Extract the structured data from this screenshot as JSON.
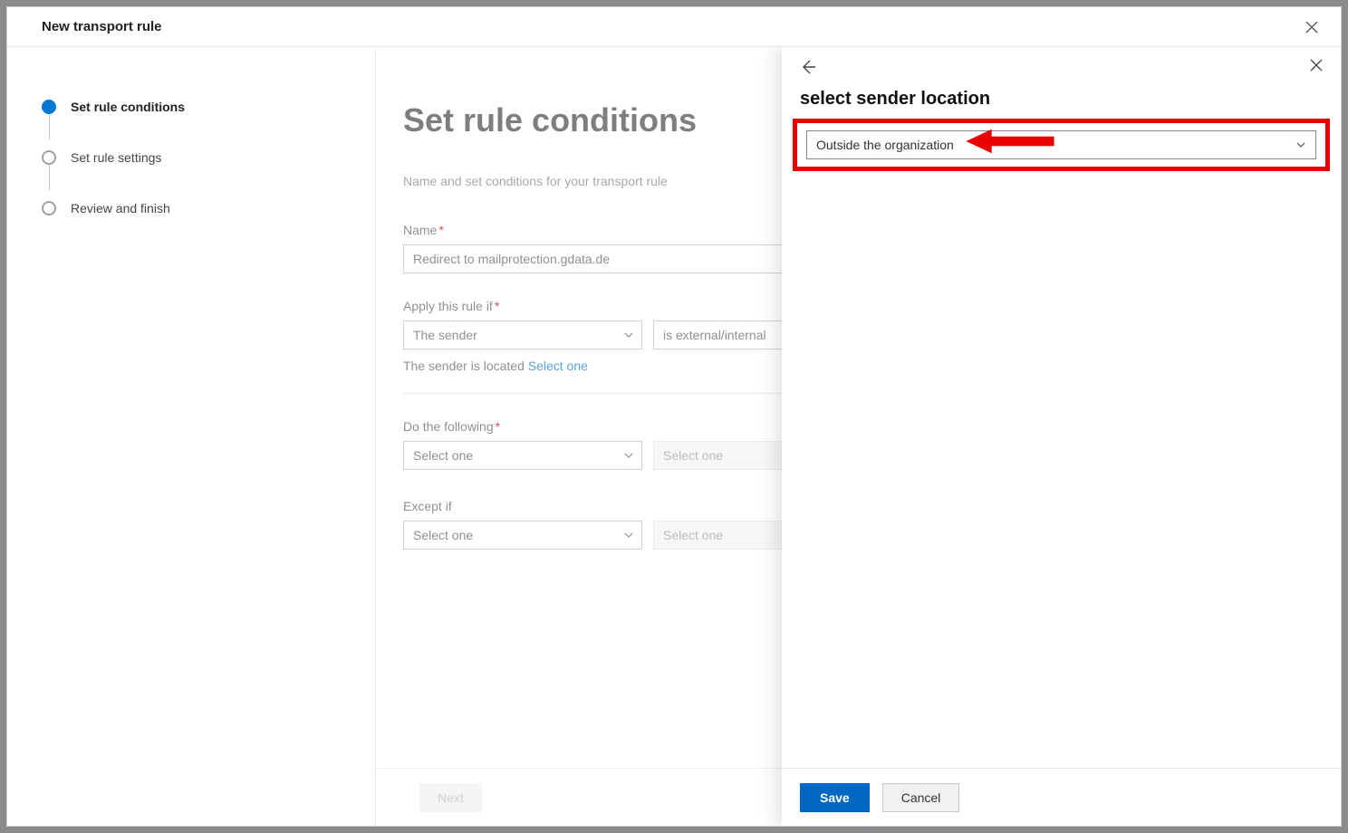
{
  "header": {
    "title": "New transport rule"
  },
  "sidebar": {
    "steps": [
      {
        "label": "Set rule conditions"
      },
      {
        "label": "Set rule settings"
      },
      {
        "label": "Review and finish"
      }
    ]
  },
  "main": {
    "heading": "Set rule conditions",
    "subheading": "Name and set conditions for your transport rule",
    "name_label": "Name",
    "name_value": "Redirect to mailprotection.gdata.de",
    "apply_if_label": "Apply this rule if",
    "apply_if_dd1": "The sender",
    "apply_if_dd2": "is external/internal",
    "sender_located_prefix": "The sender is located ",
    "sender_located_link": "Select one",
    "do_following_label": "Do the following",
    "do_following_dd1": "Select one",
    "do_following_dd2": "Select one",
    "except_if_label": "Except if",
    "except_if_dd1": "Select one",
    "except_if_dd2": "Select one",
    "next_label": "Next",
    "required_marker": "*"
  },
  "flyout": {
    "title": "select sender location",
    "dropdown_value": "Outside the organization",
    "save_label": "Save",
    "cancel_label": "Cancel"
  }
}
